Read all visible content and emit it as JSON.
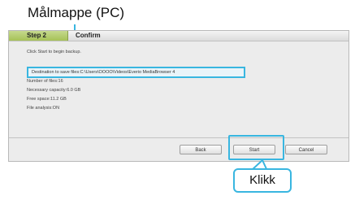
{
  "annotations": {
    "top_label": "Målmappe (PC)",
    "callout_label": "Klikk"
  },
  "dialog": {
    "step_label": "Step 2",
    "confirm_label": "Confirm",
    "instruction": "Click Start to begin backup.",
    "destination": "Destination to save files:C:\\Users\\OOOO\\Videos\\Everio MediaBrowser 4",
    "info_lines": [
      "Number of files:16",
      "Necessary capacity:6.0 GB",
      "Free space:11.2 GB",
      "File analysis:ON"
    ],
    "buttons": {
      "back": "Back",
      "start": "Start",
      "cancel": "Cancel"
    }
  },
  "colors": {
    "highlight": "#39b6e0",
    "step_tab": "#a6c257"
  }
}
